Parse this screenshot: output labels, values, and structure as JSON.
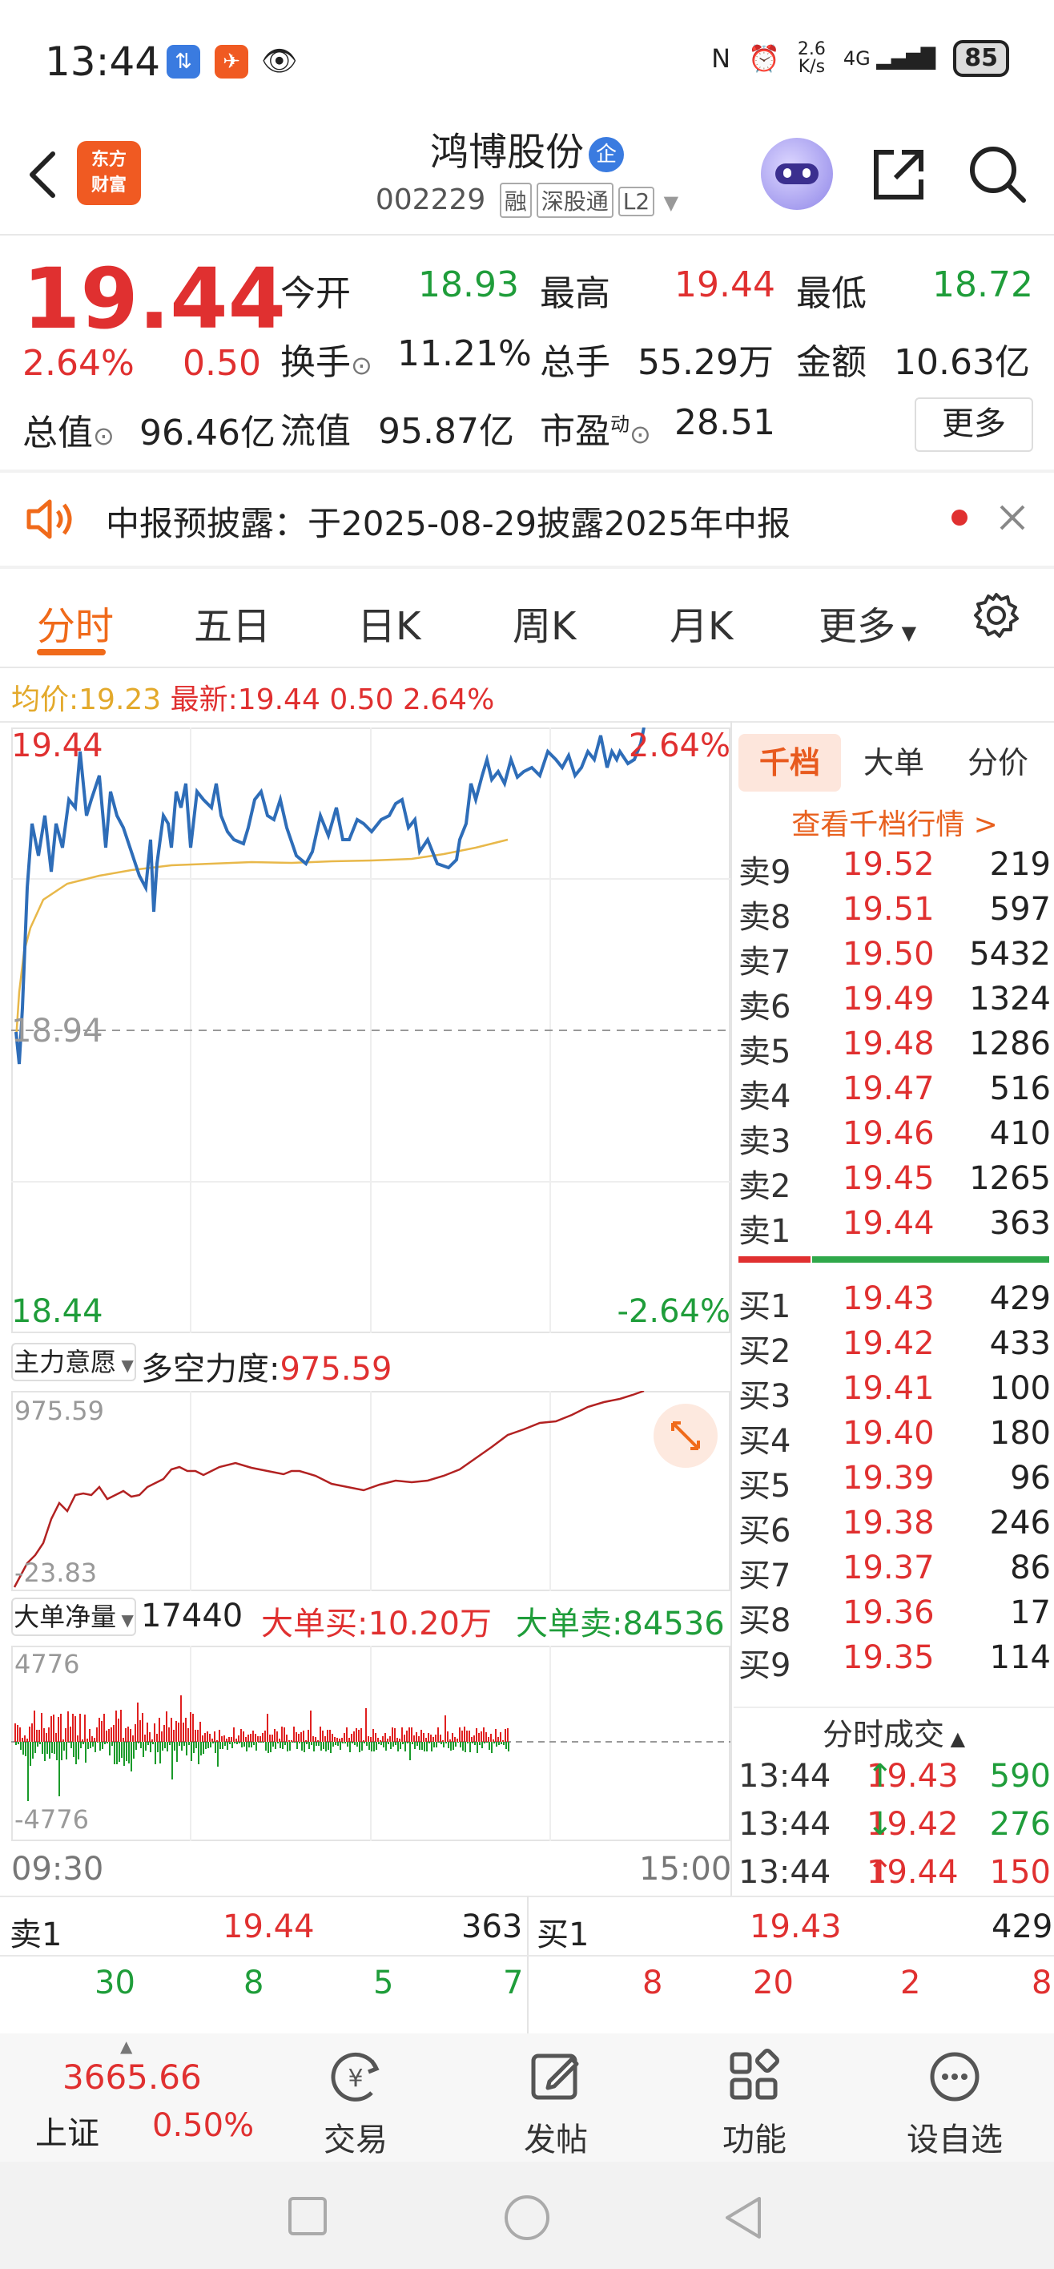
{
  "status_bar": {
    "time": "13:44",
    "net_speed_top": "2.6",
    "net_speed_unit": "K/s",
    "signal": "4G",
    "battery": "85"
  },
  "header": {
    "logo_line1": "东方",
    "logo_line2": "财富",
    "stock_name": "鸿博股份",
    "stock_badge": "企",
    "stock_code": "002229",
    "tags": [
      "融",
      "深股通",
      "L2"
    ]
  },
  "quote": {
    "price": "19.44",
    "change_pct": "2.64%",
    "change": "0.50",
    "open_label": "今开",
    "open": "18.93",
    "high_label": "最高",
    "high": "19.44",
    "low_label": "最低",
    "low": "18.72",
    "turnover_label": "换手",
    "turnover": "11.21%",
    "volume_label": "总手",
    "volume": "55.29万",
    "amount_label": "金额",
    "amount": "10.63亿",
    "mktcap_label": "总值",
    "mktcap": "96.46亿",
    "float_label": "流值",
    "float": "95.87亿",
    "pe_label": "市盈",
    "pe_sup": "动",
    "pe": "28.51",
    "more_label": "更多"
  },
  "announcement": {
    "text": "中报预披露：于2025-08-29披露2025年中报"
  },
  "tabs": [
    "分时",
    "五日",
    "日K",
    "周K",
    "月K",
    "更多"
  ],
  "avg_line": {
    "avg_label": "均价:",
    "avg": "19.23",
    "latest_label": "最新:",
    "latest": "19.44",
    "change": "0.50",
    "pct": "2.64%"
  },
  "chart": {
    "y_top": "19.44",
    "y_mid": "18.94",
    "y_bottom": "18.44",
    "pct_top": "2.64%",
    "pct_bottom": "-2.64%",
    "ind1_label": "主力意愿",
    "ind1_name": "多空力度:",
    "ind1_value": "975.59",
    "ind1_top": "975.59",
    "ind1_bottom": "-23.83",
    "ind2_label": "大单净量",
    "ind2_value": "17440",
    "ind2_buy": "大单买:10.20万",
    "ind2_sell": "大单卖:84536",
    "ind2_top": "4776",
    "ind2_bottom": "-4776",
    "time_start": "09:30",
    "time_end": "15:00",
    "colors": {
      "price": "#2e6db8",
      "avg": "#e8b84a",
      "ind": "#b22222",
      "up": "#e02020",
      "down": "#1a9a2a"
    }
  },
  "order_book": {
    "tabs": [
      "千档",
      "大单",
      "分价"
    ],
    "link": "查看千档行情 >",
    "asks": [
      {
        "label": "卖9",
        "price": "19.52",
        "vol": "219"
      },
      {
        "label": "卖8",
        "price": "19.51",
        "vol": "597"
      },
      {
        "label": "卖7",
        "price": "19.50",
        "vol": "5432"
      },
      {
        "label": "卖6",
        "price": "19.49",
        "vol": "1324"
      },
      {
        "label": "卖5",
        "price": "19.48",
        "vol": "1286"
      },
      {
        "label": "卖4",
        "price": "19.47",
        "vol": "516"
      },
      {
        "label": "卖3",
        "price": "19.46",
        "vol": "410"
      },
      {
        "label": "卖2",
        "price": "19.45",
        "vol": "1265"
      },
      {
        "label": "卖1",
        "price": "19.44",
        "vol": "363"
      }
    ],
    "bids": [
      {
        "label": "买1",
        "price": "19.43",
        "vol": "429"
      },
      {
        "label": "买2",
        "price": "19.42",
        "vol": "433"
      },
      {
        "label": "买3",
        "price": "19.41",
        "vol": "100"
      },
      {
        "label": "买4",
        "price": "19.40",
        "vol": "180"
      },
      {
        "label": "买5",
        "price": "19.39",
        "vol": "96"
      },
      {
        "label": "买6",
        "price": "19.38",
        "vol": "246"
      },
      {
        "label": "买7",
        "price": "19.37",
        "vol": "86"
      },
      {
        "label": "买8",
        "price": "19.36",
        "vol": "17"
      },
      {
        "label": "买9",
        "price": "19.35",
        "vol": "114"
      }
    ],
    "trades_title": "分时成交",
    "trades": [
      {
        "time": "13:44",
        "price": "19.43",
        "dir": "↑",
        "vol": "590",
        "color": "#1f9d3a"
      },
      {
        "time": "13:44",
        "price": "19.42",
        "dir": "↓",
        "vol": "276",
        "color": "#1f9d3a"
      },
      {
        "time": "13:44",
        "price": "19.44",
        "dir": "↑",
        "vol": "150",
        "color": "#e03030"
      }
    ]
  },
  "ladder": {
    "sell_label": "卖1",
    "sell_price": "19.44",
    "sell_vol": "363",
    "buy_label": "买1",
    "buy_price": "19.43",
    "buy_vol": "429",
    "sell_queue": [
      "30",
      "8",
      "5",
      "7"
    ],
    "buy_queue": [
      "8",
      "20",
      "2",
      "8"
    ]
  },
  "index": {
    "value": "3665.66",
    "name": "上证",
    "pct": "0.50%"
  },
  "nav": [
    "交易",
    "发帖",
    "功能",
    "设自选"
  ]
}
